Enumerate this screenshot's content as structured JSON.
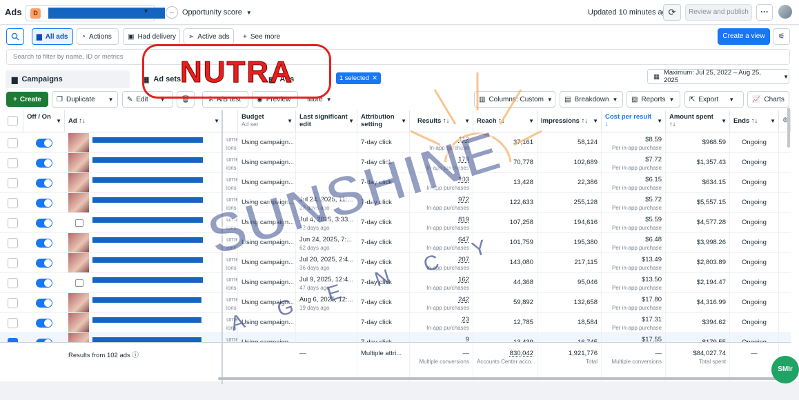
{
  "topbar": {
    "title": "Ads",
    "account_badge": "D",
    "opportunity_label": "Opportunity score",
    "opportunity_value": "--",
    "updated": "Updated 10 minutes ago",
    "review_publish": "Review and publish"
  },
  "toolbar": {
    "all_ads": "All ads",
    "actions": "Actions",
    "had_delivery": "Had delivery",
    "active_ads": "Active ads",
    "see_more": "See more",
    "create_view": "Create a view"
  },
  "filter_placeholder": "Search to filter by name, ID or metrics",
  "tabs": {
    "campaigns": "Campaigns",
    "adsets": "Ad sets",
    "ads": "Ads",
    "selected": "1 selected"
  },
  "date_range": "Maximum: Jul 25, 2022 – Aug 25, 2025",
  "actions_row": {
    "create": "Create",
    "duplicate": "Duplicate",
    "edit": "Edit",
    "ab_test": "A/B test",
    "preview": "Preview",
    "more": "More",
    "columns": "Columns: Custom",
    "breakdown": "Breakdown",
    "reports": "Reports",
    "export": "Export",
    "charts": "Charts"
  },
  "overlay": {
    "label": "NUTRA",
    "watermark_main": "SUNSHINE",
    "watermark_sub": "A G E N C Y",
    "badge": "SMIr"
  },
  "columns": {
    "off_on": "Off / On",
    "ad": "Ad",
    "budget": "Budget",
    "budget_sub": "Ad set",
    "last_edit": "Last significant edit",
    "attribution": "Attribution setting",
    "results": "Results",
    "reach": "Reach",
    "impressions": "Impressions",
    "cost": "Cost per result",
    "amount": "Amount spent",
    "ends": "Ends"
  },
  "rows": [
    {
      "budget": "Using campaign...",
      "last_edit": "",
      "last_edit_sub": "",
      "attribution": "7-day click",
      "results": "112",
      "results_sub": "In-app purchase",
      "reach": "37,161",
      "impressions": "58,124",
      "cost": "$8.59",
      "cost_sub": "Per in-app purchase",
      "amount": "$968.59",
      "ends": "Ongoing",
      "thumb": "photo",
      "checked": false
    },
    {
      "budget": "Using campaign...",
      "last_edit": "",
      "last_edit_sub": "",
      "attribution": "7-day click",
      "results": "176",
      "results_sub": "In-app purchases",
      "reach": "70,778",
      "impressions": "102,689",
      "cost": "$7.72",
      "cost_sub": "Per in-app purchase",
      "amount": "$1,357.43",
      "ends": "Ongoing",
      "thumb": "photo",
      "checked": false
    },
    {
      "budget": "Using campaign...",
      "last_edit": "",
      "last_edit_sub": "",
      "attribution": "7-day click",
      "results": "103",
      "results_sub": "In-app purchases",
      "reach": "13,428",
      "impressions": "22,386",
      "cost": "$6.15",
      "cost_sub": "Per in-app purchase",
      "amount": "$634.15",
      "ends": "Ongoing",
      "thumb": "photo",
      "checked": false
    },
    {
      "budget": "Using campaign...",
      "last_edit": "Jul 24, 2025, 11:...",
      "last_edit_sub": "32 days ago",
      "attribution": "7-day click",
      "results": "972",
      "results_sub": "In-app purchases",
      "reach": "122,633",
      "impressions": "255,128",
      "cost": "$5.72",
      "cost_sub": "Per in-app purchase",
      "amount": "$5,557.15",
      "ends": "Ongoing",
      "thumb": "photo",
      "checked": false
    },
    {
      "budget": "Using campaign...",
      "last_edit": "Jul 4, 2025, 3:33...",
      "last_edit_sub": "52 days ago",
      "attribution": "7-day click",
      "results": "819",
      "results_sub": "In-app purchases",
      "reach": "107,258",
      "impressions": "194,616",
      "cost": "$5.59",
      "cost_sub": "Per in-app purchase",
      "amount": "$4,577.28",
      "ends": "Ongoing",
      "thumb": "placeholder",
      "checked": false
    },
    {
      "budget": "Using campaign...",
      "last_edit": "Jun 24, 2025, 7:...",
      "last_edit_sub": "62 days ago",
      "attribution": "7-day click",
      "results": "647",
      "results_sub": "In-app purchases",
      "reach": "101,759",
      "impressions": "195,380",
      "cost": "$6.48",
      "cost_sub": "Per in-app purchase",
      "amount": "$3,998.26",
      "ends": "Ongoing",
      "thumb": "photo",
      "checked": false
    },
    {
      "budget": "Using campaign...",
      "last_edit": "Jul 20, 2025, 2:4...",
      "last_edit_sub": "36 days ago",
      "attribution": "7-day click",
      "results": "207",
      "results_sub": "In-app purchases",
      "reach": "143,080",
      "impressions": "217,115",
      "cost": "$13.49",
      "cost_sub": "Per in-app purchase",
      "amount": "$2,803.89",
      "ends": "Ongoing",
      "thumb": "photo",
      "checked": false
    },
    {
      "budget": "Using campaign...",
      "last_edit": "Jul 9, 2025, 12:4...",
      "last_edit_sub": "47 days ago",
      "attribution": "7-day click",
      "results": "162",
      "results_sub": "In-app purchases",
      "reach": "44,368",
      "impressions": "95,046",
      "cost": "$13.50",
      "cost_sub": "Per in-app purchase",
      "amount": "$2,194.47",
      "ends": "Ongoing",
      "thumb": "placeholder",
      "checked": false
    },
    {
      "budget": "Using campaign...",
      "last_edit": "Aug 6, 2025, 12:...",
      "last_edit_sub": "19 days ago",
      "attribution": "7-day click",
      "results": "242",
      "results_sub": "In-app purchases",
      "reach": "59,892",
      "impressions": "132,658",
      "cost": "$17.80",
      "cost_sub": "Per in-app purchase",
      "amount": "$4,316.99",
      "ends": "Ongoing",
      "thumb": "photo",
      "checked": false
    },
    {
      "budget": "Using campaign...",
      "last_edit": "",
      "last_edit_sub": "",
      "attribution": "7-day click",
      "results": "23",
      "results_sub": "In-app purchases",
      "reach": "12,785",
      "impressions": "18,584",
      "cost": "$17.31",
      "cost_sub": "Per in-app purchase",
      "amount": "$394.62",
      "ends": "Ongoing",
      "thumb": "photo",
      "checked": false
    },
    {
      "budget": "Using campaign...",
      "last_edit": "",
      "last_edit_sub": "",
      "attribution": "7-day click",
      "results": "9",
      "results_sub": "",
      "reach": "13,439",
      "impressions": "16,745",
      "cost": "$17.55",
      "cost_sub": "",
      "amount": "$179.55",
      "ends": "Ongoing",
      "thumb": "photo",
      "checked": true
    }
  ],
  "footer": {
    "results_from": "Results from 102 ads",
    "last_edit": "—",
    "attribution": "Multiple attri...",
    "results": "—",
    "results_sub": "Multiple conversions",
    "reach": "830,042",
    "reach_sub": "Accounts Center acco...",
    "impressions": "1,921,776",
    "impressions_sub": "Total",
    "cost": "—",
    "cost_sub": "Multiple conversions",
    "amount": "$84,027.74",
    "amount_sub": "Total spent",
    "ends": "—"
  }
}
